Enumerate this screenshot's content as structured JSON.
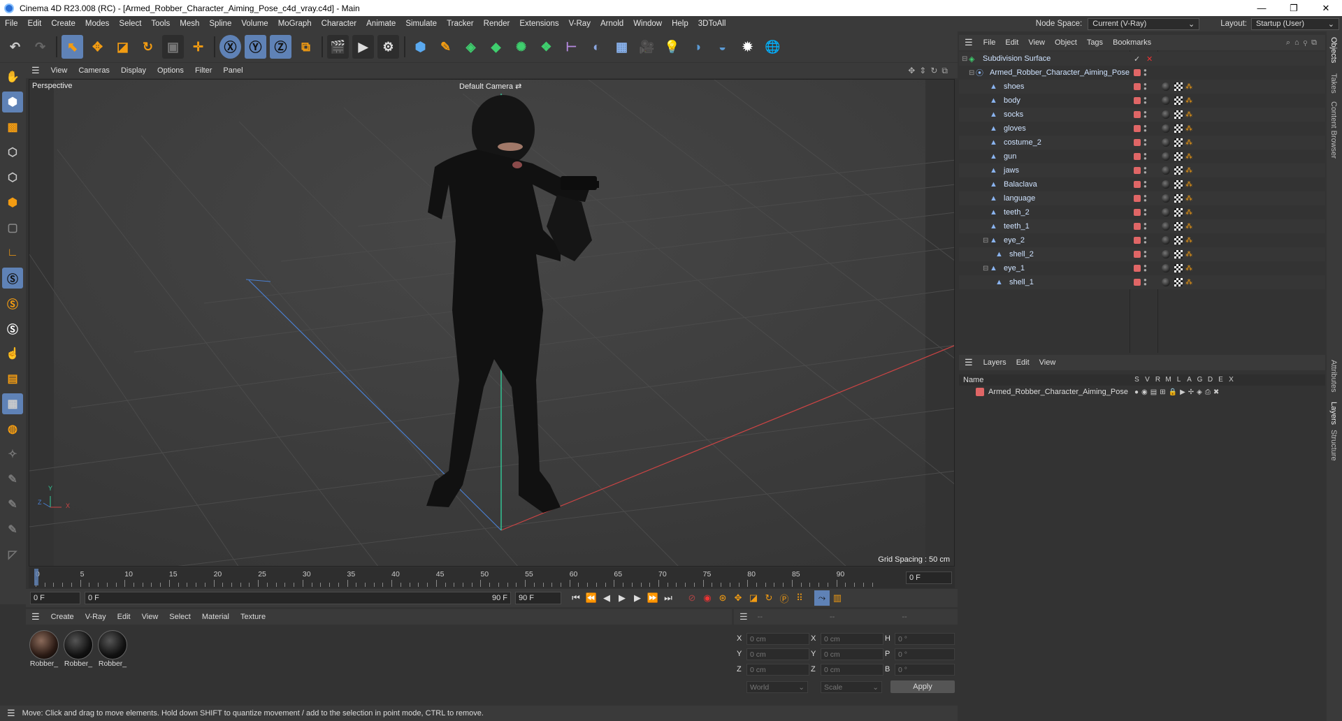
{
  "window": {
    "title": "Cinema 4D R23.008 (RC) - [Armed_Robber_Character_Aiming_Pose_c4d_vray.c4d] - Main",
    "minimize": "—",
    "maximize": "❐",
    "close": "✕"
  },
  "menubar": {
    "items": [
      "File",
      "Edit",
      "Create",
      "Modes",
      "Select",
      "Tools",
      "Mesh",
      "Spline",
      "Volume",
      "MoGraph",
      "Character",
      "Animate",
      "Simulate",
      "Tracker",
      "Render",
      "Extensions",
      "V-Ray",
      "Arnold",
      "Window",
      "Help",
      "3DToAll"
    ],
    "node_space_label": "Node Space:",
    "node_space_value": "Current (V-Ray)",
    "layout_label": "Layout:",
    "layout_value": "Startup (User)"
  },
  "viewport": {
    "menu": [
      "View",
      "Cameras",
      "Display",
      "Options",
      "Filter",
      "Panel"
    ],
    "projection": "Perspective",
    "camera": "Default Camera",
    "grid_spacing": "Grid Spacing : 50 cm",
    "axis_y": "Y",
    "axis_x": "X",
    "axis_z": "Z"
  },
  "timeline": {
    "ticks": [
      "0",
      "5",
      "10",
      "15",
      "20",
      "25",
      "30",
      "35",
      "40",
      "45",
      "50",
      "55",
      "60",
      "65",
      "70",
      "75",
      "80",
      "85",
      "90"
    ],
    "current_frame": "0 F",
    "start_field": "0 F",
    "range_start": "0 F",
    "range_end": "90 F",
    "end_field": "90 F"
  },
  "materials": {
    "menu": [
      "Create",
      "V-Ray",
      "Edit",
      "View",
      "Select",
      "Material",
      "Texture"
    ],
    "items": [
      "Robber_",
      "Robber_",
      "Robber_"
    ]
  },
  "coordinates": {
    "header": [
      "--",
      "--",
      "--"
    ],
    "rows": [
      {
        "a_label": "X",
        "a_val": "0 cm",
        "b_label": "X",
        "b_val": "0 cm",
        "c_label": "H",
        "c_val": "0 °"
      },
      {
        "a_label": "Y",
        "a_val": "0 cm",
        "b_label": "Y",
        "b_val": "0 cm",
        "c_label": "P",
        "c_val": "0 °"
      },
      {
        "a_label": "Z",
        "a_val": "0 cm",
        "b_label": "Z",
        "b_val": "0 cm",
        "c_label": "B",
        "c_val": "0 °"
      }
    ],
    "mode1": "World",
    "mode2": "Scale",
    "apply": "Apply"
  },
  "status": {
    "text": "Move: Click and drag to move elements. Hold down SHIFT to quantize movement / add to the selection in point mode, CTRL to remove."
  },
  "objects": {
    "menu": [
      "File",
      "Edit",
      "View",
      "Object",
      "Tags",
      "Bookmarks"
    ],
    "items": [
      {
        "name": "Subdivision Surface",
        "indent": 0
      },
      {
        "name": "Armed_Robber_Character_Aiming_Pose",
        "indent": 1
      },
      {
        "name": "shoes",
        "indent": 2
      },
      {
        "name": "body",
        "indent": 2
      },
      {
        "name": "socks",
        "indent": 2
      },
      {
        "name": "gloves",
        "indent": 2
      },
      {
        "name": "costume_2",
        "indent": 2
      },
      {
        "name": "gun",
        "indent": 2
      },
      {
        "name": "jaws",
        "indent": 2
      },
      {
        "name": "Balaclava",
        "indent": 2
      },
      {
        "name": "language",
        "indent": 2
      },
      {
        "name": "teeth_2",
        "indent": 2
      },
      {
        "name": "teeth_1",
        "indent": 2
      },
      {
        "name": "eye_2",
        "indent": 2
      },
      {
        "name": "shell_2",
        "indent": 3
      },
      {
        "name": "eye_1",
        "indent": 2
      },
      {
        "name": "shell_1",
        "indent": 3
      }
    ]
  },
  "layers": {
    "menu": [
      "Layers",
      "Edit",
      "View"
    ],
    "header_name": "Name",
    "header_cols": [
      "S",
      "V",
      "R",
      "M",
      "L",
      "A",
      "G",
      "D",
      "E",
      "X"
    ],
    "items": [
      {
        "name": "Armed_Robber_Character_Aiming_Pose",
        "color": "#e06666"
      }
    ]
  },
  "right_tabs": [
    "Objects",
    "Takes",
    "Content Browser",
    "Attributes",
    "Layers",
    "Structure"
  ],
  "colors": {
    "accent_orange": "#f39c12",
    "selected_blue": "#5f82b6",
    "layer_red": "#e06666"
  }
}
